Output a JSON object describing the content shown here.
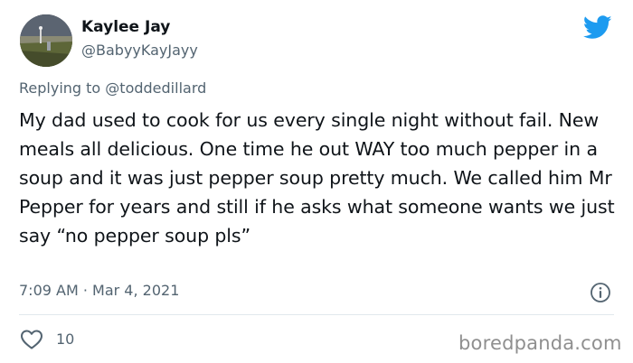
{
  "author": {
    "name": "Kaylee Jay",
    "handle": "@BabyyKayJayy"
  },
  "reply": {
    "prefix": "Replying to ",
    "mention": "@toddedillard"
  },
  "tweet": {
    "text": "My dad used to cook for us every single night without fail. New meals all delicious. One time he out WAY too much pepper in a soup and it was just pepper soup pretty much. We called him Mr Pepper for years and still if he asks what someone wants we just say “no pepper soup pls”",
    "timestamp": "7:09 AM · Mar 4, 2021"
  },
  "engagement": {
    "likes": "10"
  },
  "watermark": "boredpanda.com",
  "icons": {
    "brand": "twitter-bird-icon",
    "info": "info-icon",
    "like": "heart-icon"
  },
  "colors": {
    "twitter_blue": "#1d9bf0",
    "secondary_text": "#536471",
    "primary_text": "#0f1419"
  }
}
